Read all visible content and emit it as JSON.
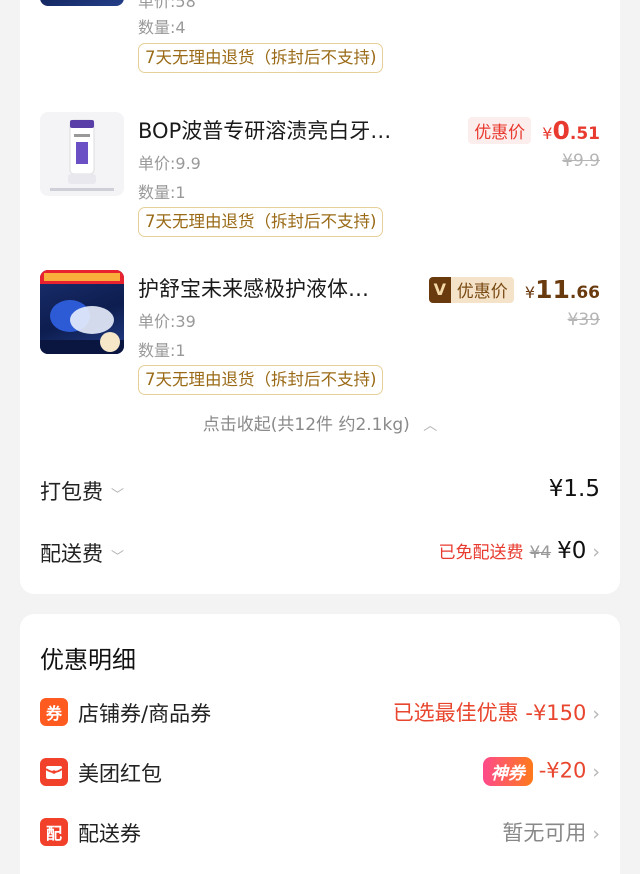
{
  "items": [
    {
      "unit_price": "单价:58",
      "quantity": "数量:4",
      "tag": "7天无理由退货（拆封后不支持)"
    },
    {
      "name": "BOP波普专研溶渍亮白牙…",
      "unit_price": "单价:9.9",
      "quantity": "数量:1",
      "tag": "7天无理由退货（拆封后不支持)",
      "price_label": "优惠价",
      "price_cur": "¥",
      "price_int": "0",
      "price_dec": ".51",
      "orig_price": "¥9.9"
    },
    {
      "name": "护舒宝未来感极护液体…",
      "unit_price": "单价:39",
      "quantity": "数量:1",
      "tag": "7天无理由退货（拆封后不支持)",
      "vip_mark": "V",
      "price_label": "优惠价",
      "price_cur": "¥",
      "price_int": "11",
      "price_dec": ".66",
      "orig_price": "¥39"
    }
  ],
  "collapse_text": "点击收起(共12件 约2.1kg)",
  "packing_fee": {
    "label": "打包费",
    "value": "¥1.5"
  },
  "delivery_fee": {
    "label": "配送费",
    "free_text": "已免配送费",
    "orig": "¥4",
    "value": "¥0"
  },
  "discount_section": {
    "title": "优惠明细",
    "rows": [
      {
        "icon_char": "券",
        "label": "店铺券/商品券",
        "value": "已选最佳优惠 -¥150"
      },
      {
        "icon_char": "",
        "label": "美团红包",
        "badge": "神券",
        "value": "-¥20"
      },
      {
        "icon_char": "配",
        "label": "配送券",
        "value": "暂无可用"
      }
    ]
  },
  "colors": {
    "accent_red": "#e83a2f",
    "vip_brown": "#6a3a0f",
    "tag_gold": "#9a6a17"
  }
}
